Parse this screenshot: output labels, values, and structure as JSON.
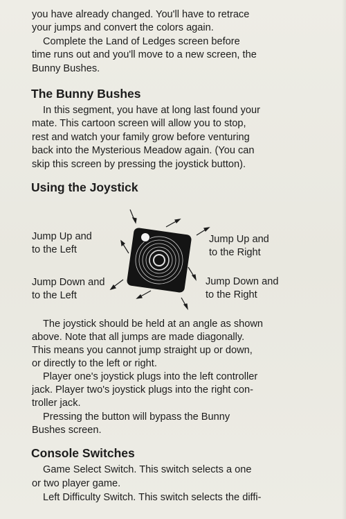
{
  "intro": {
    "lines": [
      "you have already changed. You'll have to retrace",
      "your jumps and convert the colors again.",
      "Complete the Land of Ledges screen before",
      "time runs out and you'll move to a new screen, the",
      "Bunny Bushes."
    ]
  },
  "bunny_bushes": {
    "heading": "The Bunny Bushes",
    "lines": [
      "In this segment, you have at long last found your",
      "mate. This cartoon screen will allow you to stop,",
      "rest and watch your family grow before venturing",
      "back into the Mysterious Meadow again. (You can",
      "skip this screen by pressing the joystick button)."
    ]
  },
  "joystick": {
    "heading": "Using the Joystick",
    "labels": {
      "up_left": [
        "Jump Up and",
        "to the Left"
      ],
      "up_right": [
        "Jump Up and",
        "to the Right"
      ],
      "down_left": [
        "Jump Down and",
        "to the Left"
      ],
      "down_right": [
        "Jump Down and",
        "to the Right"
      ]
    },
    "body_lines": [
      "The joystick should be held at an angle as shown",
      "above. Note that all jumps are made diagonally.",
      "This means you cannot jump straight up or down,",
      "or directly to the left or right.",
      "Player one's joystick plugs into the left controller",
      "jack. Player two's joystick plugs into the right con-",
      "troller jack.",
      "Pressing the button will bypass the Bunny",
      "Bushes screen."
    ]
  },
  "console": {
    "heading": "Console Switches",
    "lines": [
      "Game Select Switch. This switch selects a one",
      "or two player game.",
      "Left Difficulty Switch. This switch selects the diffi-"
    ]
  }
}
